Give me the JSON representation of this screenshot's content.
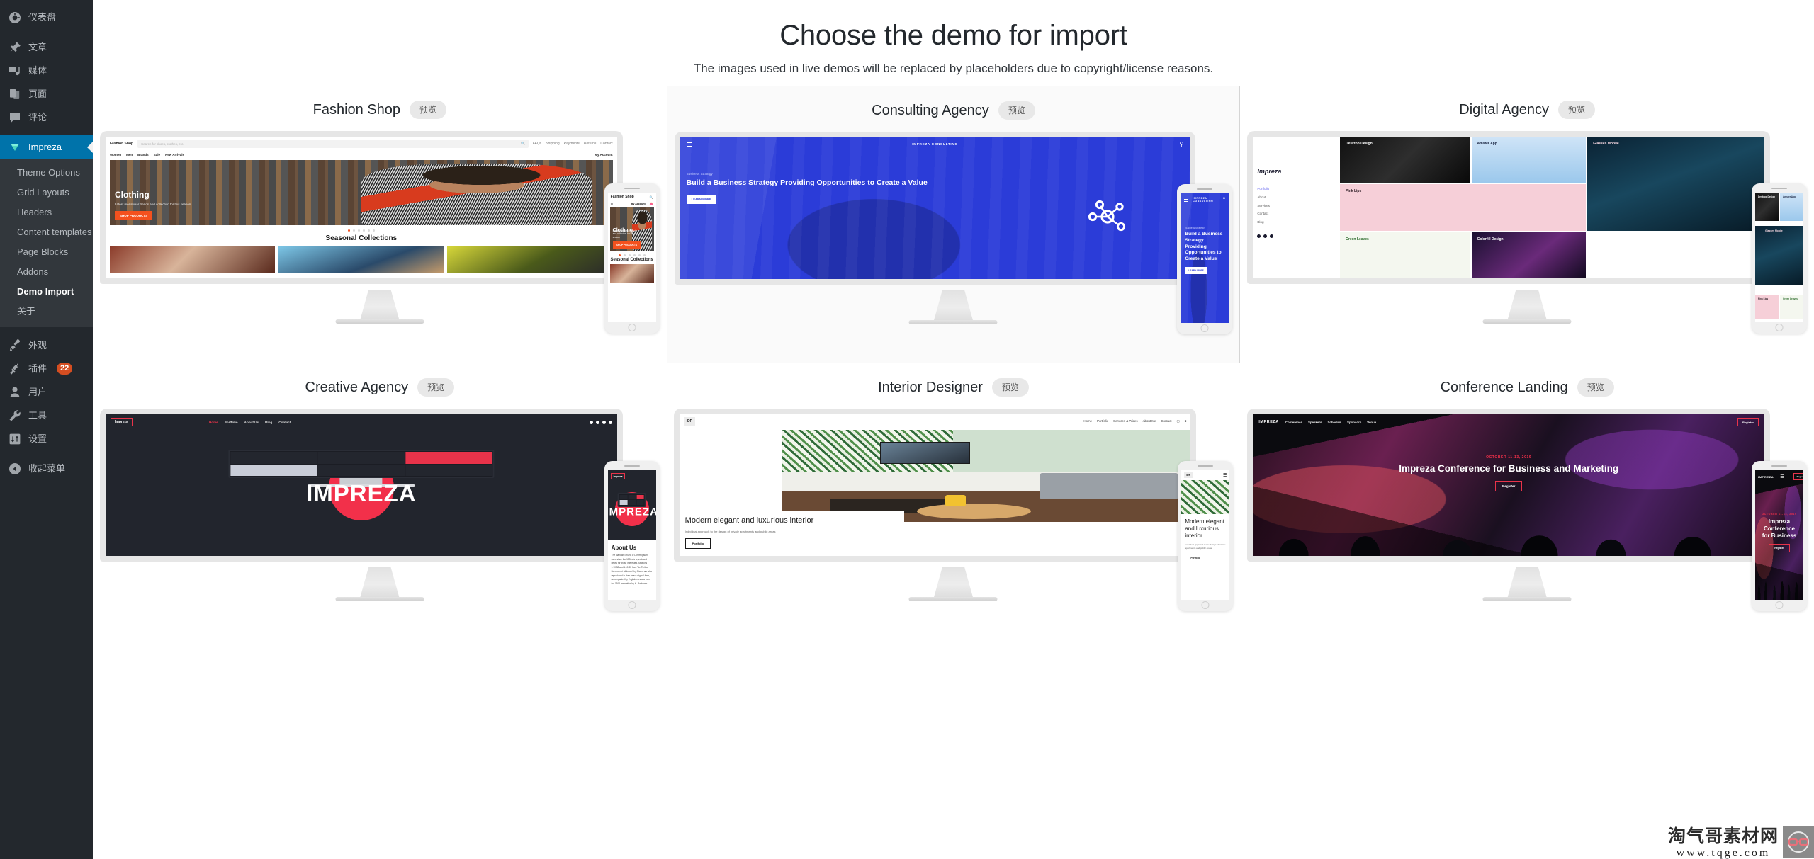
{
  "sidebar": {
    "top_items": [
      {
        "label": "仪表盘",
        "icon": "dashboard-icon"
      },
      {
        "label": "文章",
        "icon": "pin-icon"
      },
      {
        "label": "媒体",
        "icon": "media-icon"
      },
      {
        "label": "页面",
        "icon": "pages-icon"
      },
      {
        "label": "评论",
        "icon": "comments-icon"
      }
    ],
    "active_item": {
      "label": "Impreza",
      "icon": "gem-icon"
    },
    "submenu": [
      {
        "label": "Theme Options",
        "current": false
      },
      {
        "label": "Grid Layouts",
        "current": false
      },
      {
        "label": "Headers",
        "current": false
      },
      {
        "label": "Content templates",
        "current": false
      },
      {
        "label": "Page Blocks",
        "current": false
      },
      {
        "label": "Addons",
        "current": false
      },
      {
        "label": "Demo Import",
        "current": true
      },
      {
        "label": "关于",
        "current": false
      }
    ],
    "bottom_items": [
      {
        "label": "外观",
        "icon": "brush-icon",
        "badge": ""
      },
      {
        "label": "插件",
        "icon": "plugin-icon",
        "badge": "22"
      },
      {
        "label": "用户",
        "icon": "user-icon",
        "badge": ""
      },
      {
        "label": "工具",
        "icon": "wrench-icon",
        "badge": ""
      },
      {
        "label": "设置",
        "icon": "settings-icon",
        "badge": ""
      }
    ],
    "collapse": {
      "label": "收起菜单",
      "icon": "collapse-arrow-icon"
    }
  },
  "page": {
    "title": "Choose the demo for import",
    "subtitle": "The images used in live demos will be replaced by placeholders due to copyright/license reasons.",
    "preview_label": "预览"
  },
  "demos": [
    {
      "name": "Fashion Shop",
      "selected": false,
      "site": {
        "brand": "Fashion Shop",
        "search_placeholder": "Search for shoes, clothes, etc.",
        "top_links": [
          "FAQs",
          "Shipping",
          "Payments",
          "Returns",
          "Contact"
        ],
        "nav": [
          "Women",
          "Men",
          "Brands",
          "Sale",
          "New Arrivals"
        ],
        "account": "My Account",
        "hero_title": "Clothing",
        "hero_text": "Latest menswear trends and collection for this season",
        "hero_button": "SHOP PRODUCTS",
        "section_title": "Seasonal Collections",
        "slider_dots": 6,
        "active_dot": 1
      }
    },
    {
      "name": "Consulting Agency",
      "selected": true,
      "site": {
        "brand": "IMPREZA CONSULTING",
        "eyebrow": "Business Strategy",
        "hero_title": "Build a Business Strategy Providing Opportunities to Create a Value",
        "hero_button": "LEARN MORE",
        "mobile_title": "Build a Business Strategy Providing Opportunities to Create a Value"
      }
    },
    {
      "name": "Digital Agency",
      "selected": false,
      "site": {
        "brand": "Impreza",
        "nav": [
          "Portfolio",
          "About",
          "Services",
          "Contact",
          "Blog"
        ],
        "active_nav": "Portfolio",
        "tiles": [
          "Desktop Design",
          "Amster App",
          "Glasses Mobile",
          "Pink Lips",
          "Green Leaves",
          "Colorfill Design"
        ]
      }
    },
    {
      "name": "Creative Agency",
      "selected": false,
      "site": {
        "brand": "Impreza",
        "nav": [
          "Home",
          "Portfolio",
          "About Us",
          "Blog",
          "Contact"
        ],
        "active_nav": "Home",
        "wordmark": "IMPREZA",
        "mobile_heading": "About Us",
        "mobile_text": "The standard chunk of Lorem Ipsum used since the 1500s is reproduced below for those interested. Sections 1.10.32 and 1.10.33 from \"de Finibus Bonorum et Malorum\" by Cicero are also reproduced in their exact original form, accompanied by English versions from the 1914 translation by H. Rackham."
      }
    },
    {
      "name": "Interior Designer",
      "selected": false,
      "site": {
        "brand": "IDP",
        "nav": [
          "Home",
          "Portfolio",
          "Services & Prices",
          "About Me",
          "Contact"
        ],
        "hero_title": "Modern elegant and luxurious interior",
        "hero_text": "Individual approach to the design of private apartments and public areas",
        "hero_button": "Portfolio",
        "mobile_title": "Modern elegant and luxurious interior"
      }
    },
    {
      "name": "Conference Landing",
      "selected": false,
      "site": {
        "brand": "IMPREZA",
        "nav": [
          "Conference",
          "Speakers",
          "Schedule",
          "Sponsors",
          "Venue"
        ],
        "register": "Register",
        "date": "OCTOBER 11-13, 2019",
        "hero_title": "Impreza Conference for Business and Marketing",
        "hero_button": "Register",
        "mobile_title": "Impreza Conference for Business"
      }
    }
  ],
  "watermark": {
    "cn_text": "淘气哥素材网",
    "url": "www.tqge.com",
    "logo": "glasses-icon"
  },
  "colors": {
    "sidebar_bg": "#23282d",
    "submenu_bg": "#32373c",
    "active_blue": "#0073aa",
    "badge_orange": "#d54e21",
    "consulting_blue": "#2b3cd8",
    "fashion_orange": "#f4511e",
    "creative_red": "#e8334a"
  }
}
